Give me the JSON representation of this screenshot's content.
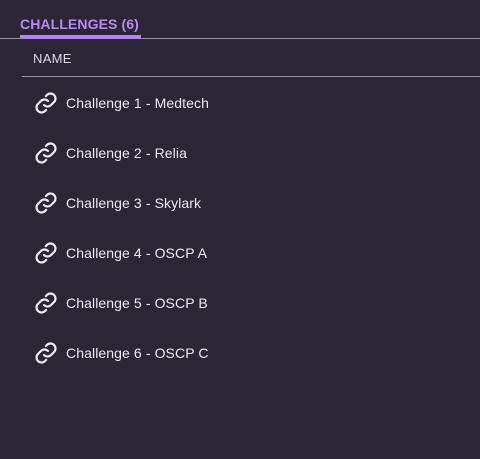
{
  "tabs": [
    {
      "label": "CHALLENGES",
      "count": "(6)",
      "active": true
    }
  ],
  "table": {
    "columns": [
      {
        "label": "NAME"
      }
    ],
    "rows": [
      {
        "name": "Challenge 1 - Medtech",
        "icon": "link-icon"
      },
      {
        "name": "Challenge 2 - Relia",
        "icon": "link-icon"
      },
      {
        "name": "Challenge 3 - Skylark",
        "icon": "link-icon"
      },
      {
        "name": "Challenge 4 - OSCP A",
        "icon": "link-icon"
      },
      {
        "name": "Challenge 5 - OSCP B",
        "icon": "link-icon"
      },
      {
        "name": "Challenge 6 - OSCP C",
        "icon": "link-icon"
      }
    ]
  },
  "colors": {
    "background": "#2b2536",
    "accent": "#b384f2",
    "text": "#ecebf1",
    "divider": "#9a95a6"
  }
}
